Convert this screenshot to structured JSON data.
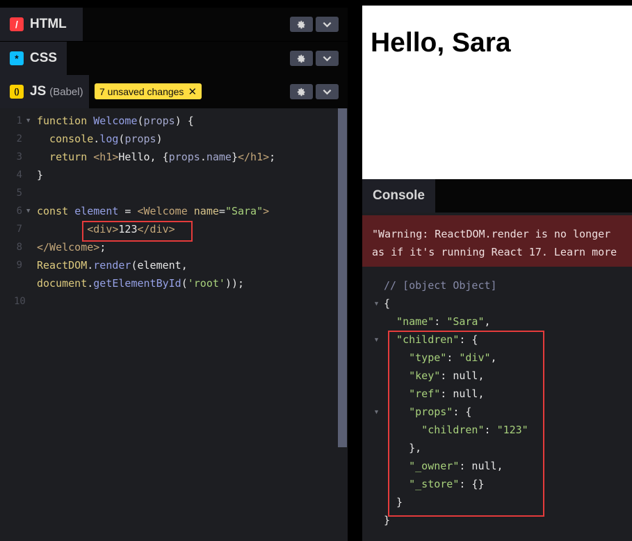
{
  "panels": {
    "html": {
      "title": "HTML",
      "icon": "/"
    },
    "css": {
      "title": "CSS",
      "icon": "*"
    },
    "js": {
      "title": "JS",
      "subtitle": "(Babel)",
      "icon": "()"
    }
  },
  "unsaved_badge": {
    "label": "7 unsaved changes",
    "close": "✕"
  },
  "editor": {
    "line_numbers": [
      "1",
      "2",
      "3",
      "4",
      "5",
      "6",
      "7",
      "8",
      "9",
      "",
      "10"
    ],
    "lines": [
      [
        {
          "t": "function ",
          "c": "kw"
        },
        {
          "t": "Welcome",
          "c": "fn"
        },
        {
          "t": "(",
          "c": ""
        },
        {
          "t": "props",
          "c": "prop"
        },
        {
          "t": ") {",
          "c": ""
        }
      ],
      [
        {
          "t": "  console",
          "c": "kw"
        },
        {
          "t": ".",
          "c": ""
        },
        {
          "t": "log",
          "c": "fn"
        },
        {
          "t": "(",
          "c": ""
        },
        {
          "t": "props",
          "c": "prop"
        },
        {
          "t": ")",
          "c": ""
        }
      ],
      [
        {
          "t": "  return ",
          "c": "kw"
        },
        {
          "t": "<h1>",
          "c": "tag"
        },
        {
          "t": "Hello, {",
          "c": ""
        },
        {
          "t": "props",
          "c": "prop"
        },
        {
          "t": ".",
          "c": ""
        },
        {
          "t": "name",
          "c": "prop"
        },
        {
          "t": "}",
          "c": ""
        },
        {
          "t": "</h1>",
          "c": "tag"
        },
        {
          "t": ";",
          "c": ""
        }
      ],
      [
        {
          "t": "}",
          "c": ""
        }
      ],
      [],
      [
        {
          "t": "const ",
          "c": "kw"
        },
        {
          "t": "element",
          "c": "fn"
        },
        {
          "t": " = ",
          "c": ""
        },
        {
          "t": "<Welcome ",
          "c": "tag"
        },
        {
          "t": "name",
          "c": "attr"
        },
        {
          "t": "=",
          "c": ""
        },
        {
          "t": "\"Sara\"",
          "c": "str"
        },
        {
          "t": ">",
          "c": "tag"
        }
      ],
      [
        {
          "t": "        ",
          "c": ""
        },
        {
          "t": "<div>",
          "c": "tag"
        },
        {
          "t": "123",
          "c": ""
        },
        {
          "t": "</div>",
          "c": "tag"
        }
      ],
      [
        {
          "t": "</Welcome>",
          "c": "tag"
        },
        {
          "t": ";",
          "c": ""
        }
      ],
      [
        {
          "t": "ReactDOM",
          "c": "kw"
        },
        {
          "t": ".",
          "c": ""
        },
        {
          "t": "render",
          "c": "fn"
        },
        {
          "t": "(element,",
          "c": ""
        }
      ],
      [
        {
          "t": "document",
          "c": "kw"
        },
        {
          "t": ".",
          "c": ""
        },
        {
          "t": "getElementById",
          "c": "fn"
        },
        {
          "t": "(",
          "c": ""
        },
        {
          "t": "'root'",
          "c": "str"
        },
        {
          "t": "));",
          "c": ""
        }
      ],
      []
    ]
  },
  "preview": {
    "heading": "Hello, Sara"
  },
  "console": {
    "tab_label": "Console",
    "warning_lines": [
      "\"Warning: ReactDOM.render is no longer",
      "as if it's running React 17. Learn more"
    ],
    "output_lines": [
      [
        {
          "t": "// [object Object]",
          "c": "comment"
        }
      ],
      [
        {
          "t": "{",
          "c": ""
        }
      ],
      [
        {
          "t": "  \"name\"",
          "c": "jkey"
        },
        {
          "t": ": ",
          "c": ""
        },
        {
          "t": "\"Sara\"",
          "c": "jstr"
        },
        {
          "t": ",",
          "c": ""
        }
      ],
      [
        {
          "t": "  \"children\"",
          "c": "jkey"
        },
        {
          "t": ": {",
          "c": ""
        }
      ],
      [
        {
          "t": "    \"type\"",
          "c": "jkey"
        },
        {
          "t": ": ",
          "c": ""
        },
        {
          "t": "\"div\"",
          "c": "jstr"
        },
        {
          "t": ",",
          "c": ""
        }
      ],
      [
        {
          "t": "    \"key\"",
          "c": "jkey"
        },
        {
          "t": ": null,",
          "c": ""
        }
      ],
      [
        {
          "t": "    \"ref\"",
          "c": "jkey"
        },
        {
          "t": ": null,",
          "c": ""
        }
      ],
      [
        {
          "t": "    \"props\"",
          "c": "jkey"
        },
        {
          "t": ": {",
          "c": ""
        }
      ],
      [
        {
          "t": "      \"children\"",
          "c": "jkey"
        },
        {
          "t": ": ",
          "c": ""
        },
        {
          "t": "\"123\"",
          "c": "jstr"
        }
      ],
      [
        {
          "t": "    },",
          "c": ""
        }
      ],
      [
        {
          "t": "    \"_owner\"",
          "c": "jkey"
        },
        {
          "t": ": null,",
          "c": ""
        }
      ],
      [
        {
          "t": "    \"_store\"",
          "c": "jkey"
        },
        {
          "t": ": {}",
          "c": ""
        }
      ],
      [
        {
          "t": "  }",
          "c": ""
        }
      ],
      [
        {
          "t": "}",
          "c": ""
        }
      ]
    ]
  },
  "colors": {
    "html_icon": "#ff3c41",
    "css_icon": "#0ebeff",
    "js_icon": "#fcd000",
    "highlight_box": "#e53b3b",
    "warning_bg": "#5a1e21"
  },
  "icons": {
    "settings": "gear-icon",
    "collapse": "chevron-down-icon"
  }
}
